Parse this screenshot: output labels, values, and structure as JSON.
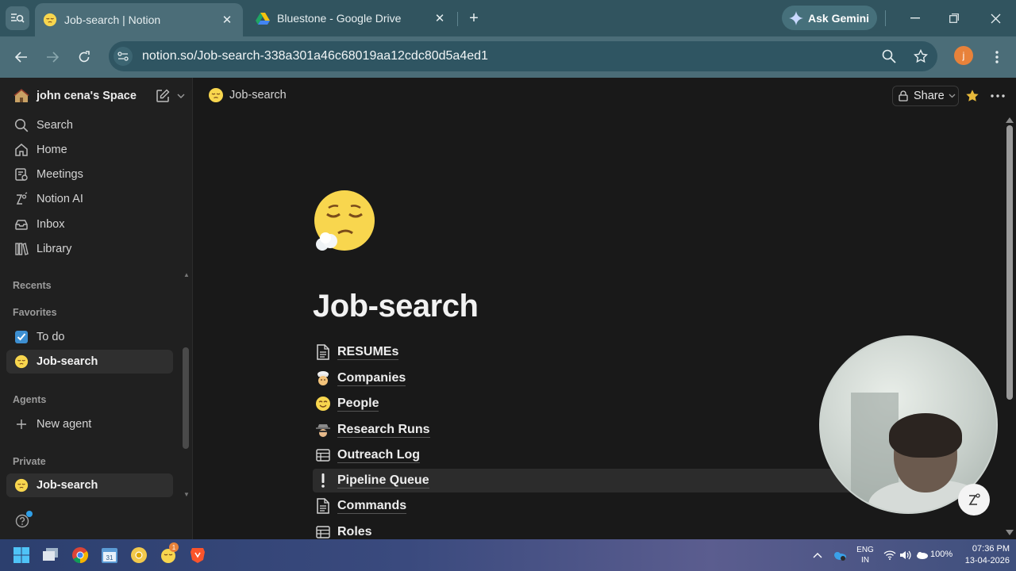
{
  "browser": {
    "tabs": [
      {
        "title": "Job-search | Notion",
        "active": true
      },
      {
        "title": "Bluestone - Google Drive",
        "active": false
      }
    ],
    "gemini_label": "Ask Gemini",
    "url": "notion.so/Job-search-338a301a46c68019aa12cdc80d5a4ed1",
    "profile_initial": "j"
  },
  "sidebar": {
    "workspace": "john cena's Space",
    "nav": [
      {
        "label": "Search",
        "icon": "search-icon"
      },
      {
        "label": "Home",
        "icon": "home-icon"
      },
      {
        "label": "Meetings",
        "icon": "meetings-icon"
      },
      {
        "label": "Notion AI",
        "icon": "notion-ai-icon"
      },
      {
        "label": "Inbox",
        "icon": "inbox-icon"
      },
      {
        "label": "Library",
        "icon": "library-icon"
      }
    ],
    "sections": {
      "recents": "Recents",
      "favorites": "Favorites",
      "agents": "Agents",
      "private": "Private"
    },
    "favorites": [
      {
        "label": "To do",
        "icon": "checkbox-icon"
      },
      {
        "label": "Job-search",
        "icon": "sleepy-face-icon"
      }
    ],
    "agents": [
      {
        "label": "New agent",
        "icon": "plus-icon"
      }
    ],
    "private": [
      {
        "label": "Job-search",
        "icon": "sleepy-face-icon"
      }
    ]
  },
  "main": {
    "breadcrumb": "Job-search",
    "share_label": "Share",
    "title": "Job-search",
    "pages": [
      {
        "label": "RESUMEs",
        "icon": "document-icon"
      },
      {
        "label": "Companies",
        "icon": "chef-emoji-icon"
      },
      {
        "label": "People",
        "icon": "smiling-face-icon"
      },
      {
        "label": "Research Runs",
        "icon": "detective-emoji-icon"
      },
      {
        "label": "Outreach Log",
        "icon": "table-icon"
      },
      {
        "label": "Pipeline Queue",
        "icon": "exclamation-icon"
      },
      {
        "label": "Commands",
        "icon": "document-icon"
      },
      {
        "label": "Roles",
        "icon": "table-icon"
      }
    ]
  },
  "taskbar": {
    "lang_top": "ENG",
    "lang_bottom": "IN",
    "battery": "100%",
    "time": "07:36 PM",
    "date": "13-04-2026",
    "notification_badge": "1"
  },
  "colors": {
    "tab_strip": "#31545f",
    "address_bar": "#4b6d78",
    "sidebar_bg": "#202020",
    "main_bg": "#191919",
    "favorite_star": "#e7b93b"
  }
}
